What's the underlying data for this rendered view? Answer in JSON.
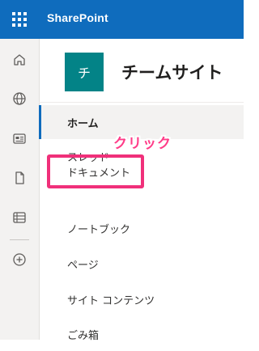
{
  "suite_bar": {
    "app_name": "SharePoint",
    "background": "#0f6cbd"
  },
  "app_bar": {
    "icons": [
      "home-icon",
      "globe-icon",
      "news-icon",
      "document-icon",
      "lists-icon",
      "add-icon"
    ]
  },
  "site": {
    "logo_char": "チ",
    "logo_color": "#038387",
    "title": "チームサイト"
  },
  "nav": {
    "items": [
      {
        "label": "ホーム",
        "selected": true
      },
      {
        "label": "スレッド",
        "selected": false
      },
      {
        "label": "ドキュメント",
        "selected": false
      },
      {
        "label": "ノートブック",
        "selected": false
      },
      {
        "label": "ページ",
        "selected": false
      },
      {
        "label": "サイト コンテンツ",
        "selected": false
      },
      {
        "label": "ごみ箱",
        "selected": false
      }
    ]
  },
  "annotation": {
    "text": "クリック",
    "color": "#ff3c88"
  }
}
